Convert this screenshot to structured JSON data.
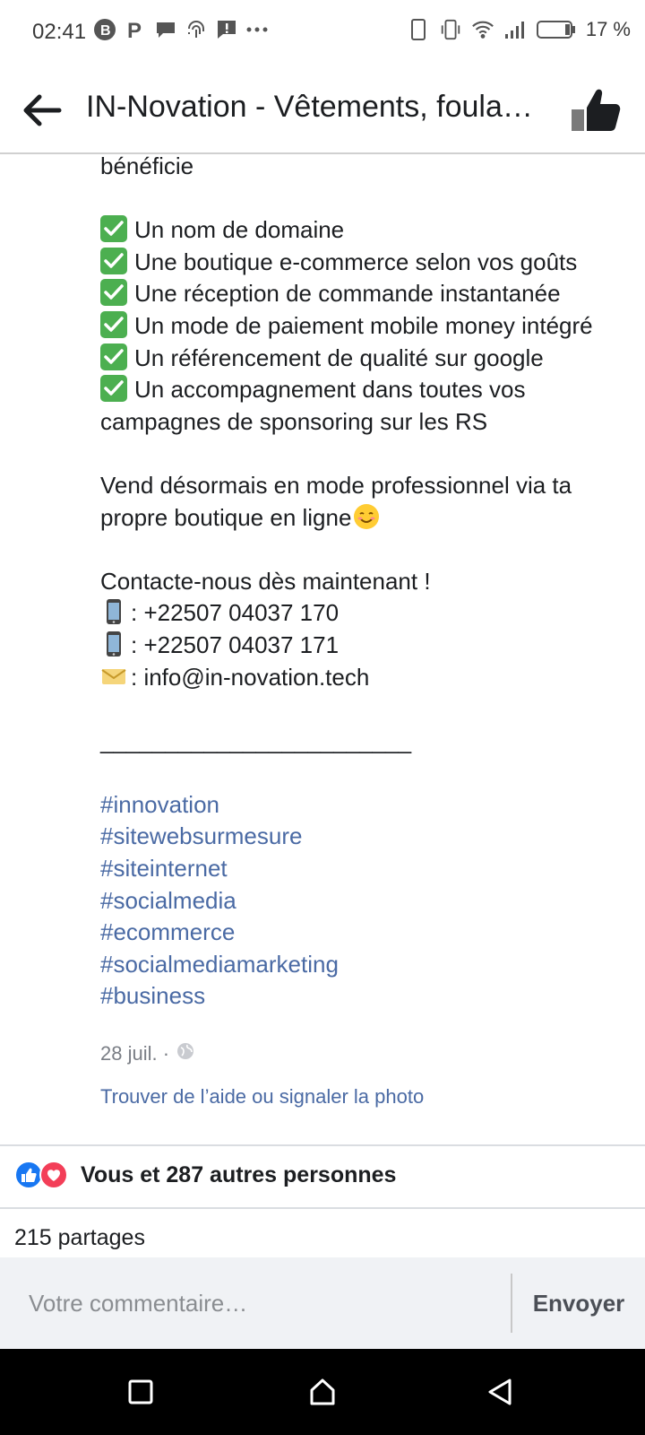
{
  "status_bar": {
    "time": "02:41",
    "battery": "17 %",
    "left_icons": [
      "b-circle-icon",
      "p-icon",
      "chat-bubble-icon",
      "fingerprint-icon",
      "alert-message-icon",
      "more-dots-icon"
    ],
    "right_icons": [
      "phone-icon",
      "vibrate-icon",
      "wifi-icon",
      "signal-icon",
      "battery-icon"
    ]
  },
  "header": {
    "title": "IN-Novation - Vêtements, foulards et accessoires"
  },
  "post": {
    "intro_tail": "bénéficie",
    "features": [
      "Un nom de domaine",
      "Une boutique e-commerce selon vos goûts",
      "Une réception de commande instantanée",
      "Un mode de paiement mobile money intégré",
      "Un référencement de qualité sur google",
      "Un accompagnement dans toutes vos"
    ],
    "feature_continuation": "campagnes de sponsoring sur les RS",
    "pitch_line1": "Vend désormais en mode professionnel via ta",
    "pitch_line2": "propre boutique en ligne",
    "contact_heading": "Contacte-nous dès maintenant !",
    "phone1": ": +22507 04037 170",
    "phone2": ": +22507 04037 171",
    "email": ": info@in-novation.tech",
    "divider": "________________________",
    "hashtags": [
      "#innovation",
      "#sitewebsurmesure",
      "#siteinternet",
      "#socialmedia",
      "#ecommerce",
      "#socialmediamarketing",
      "#business"
    ],
    "date": "28 juil. ·",
    "help_link": "Trouver de l’aide ou signaler la photo"
  },
  "reactions": {
    "text": "Vous et 287 autres personnes",
    "icons": [
      "like-reaction-icon",
      "love-reaction-icon"
    ]
  },
  "shares": "215 partages",
  "comment": {
    "placeholder": "Votre commentaire…",
    "value": "",
    "send_label": "Envoyer"
  },
  "nav": {
    "buttons": [
      "recent-apps-icon",
      "home-icon",
      "back-triangle-icon"
    ]
  },
  "colors": {
    "hashtag": "#4a6aa4",
    "like_blue": "#1877f2",
    "love_red": "#f33e58",
    "check_green": "#4caf50"
  }
}
